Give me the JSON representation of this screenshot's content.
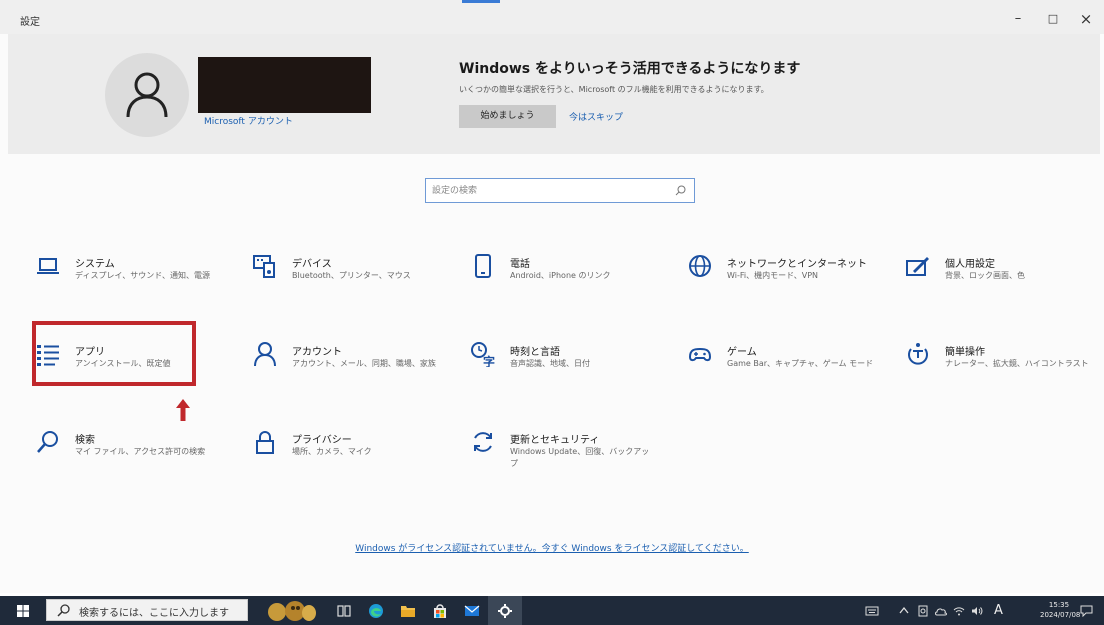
{
  "window": {
    "title": "設定",
    "minimize": "–",
    "maximize": "□",
    "close": "×"
  },
  "account": {
    "link": "Microsoft アカウント"
  },
  "promo": {
    "title": "Windows をよりいっそう活用できるようになります",
    "description": "いくつかの簡単な選択を行うと、Microsoft のフル機能を利用できるようになります。",
    "start_button": "始めましょう",
    "skip_link": "今はスキップ"
  },
  "search": {
    "placeholder": "設定の検索"
  },
  "tiles": [
    {
      "name": "システム",
      "desc": "ディスプレイ、サウンド、通知、電源",
      "icon": "laptop-icon"
    },
    {
      "name": "デバイス",
      "desc": "Bluetooth、プリンター、マウス",
      "icon": "keyboard-icon"
    },
    {
      "name": "電話",
      "desc": "Android、iPhone のリンク",
      "icon": "phone-icon"
    },
    {
      "name": "ネットワークとインターネット",
      "desc": "Wi-Fi、機内モード、VPN",
      "icon": "globe-icon"
    },
    {
      "name": "個人用設定",
      "desc": "背景、ロック画面、色",
      "icon": "paint-icon"
    },
    {
      "name": "アプリ",
      "desc": "アンインストール、既定値",
      "icon": "apps-list-icon"
    },
    {
      "name": "アカウント",
      "desc": "アカウント、メール、同期、職場、家族",
      "icon": "person-icon"
    },
    {
      "name": "時刻と言語",
      "desc": "音声認識、地域、日付",
      "icon": "time-language-icon"
    },
    {
      "name": "ゲーム",
      "desc": "Game Bar、キャプチャ、ゲーム モード",
      "icon": "gamepad-icon"
    },
    {
      "name": "簡単操作",
      "desc": "ナレーター、拡大鏡、ハイコントラスト",
      "icon": "ease-of-access-icon"
    },
    {
      "name": "検索",
      "desc": "マイ ファイル、アクセス許可の検索",
      "icon": "search-icon"
    },
    {
      "name": "プライバシー",
      "desc": "場所、カメラ、マイク",
      "icon": "lock-icon"
    },
    {
      "name": "更新とセキュリティ",
      "desc": "Windows Update、回復、バックアップ",
      "icon": "sync-icon"
    }
  ],
  "license_link": "Windows がライセンス認証されていません。今すぐ Windows をライセンス認証してください。",
  "taskbar": {
    "search_placeholder": "検索するには、ここに入力します",
    "ime": "A",
    "time": "15:35",
    "date": "2024/07/08"
  },
  "colors": {
    "accent_link": "#1b5fb0",
    "highlight": "#c0282c",
    "taskbar": "#1f2a3a"
  }
}
